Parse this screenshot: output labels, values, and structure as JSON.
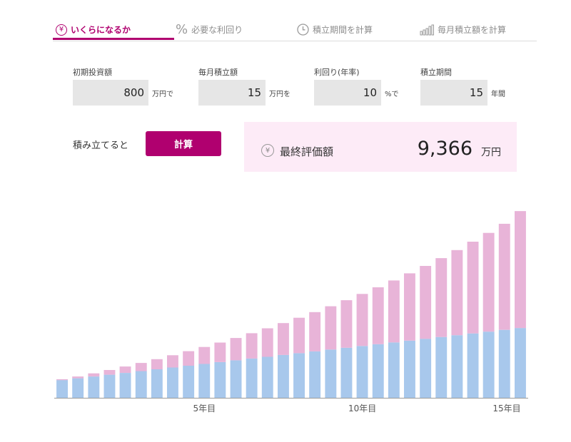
{
  "tabs": [
    {
      "label": "いくらになるか",
      "icon": "yen-circle-icon",
      "active": true
    },
    {
      "label": "必要な利回り",
      "icon": "percent-icon",
      "active": false
    },
    {
      "label": "積立期間を計算",
      "icon": "clock-icon",
      "active": false
    },
    {
      "label": "毎月積立額を計算",
      "icon": "bar-chart-icon",
      "active": false
    }
  ],
  "inputs": {
    "initial": {
      "label": "初期投資額",
      "value": "800",
      "unit": "万円で"
    },
    "monthly": {
      "label": "毎月積立額",
      "value": "15",
      "unit": "万円を"
    },
    "rate": {
      "label": "利回り(年率)",
      "value": "10",
      "unit": "%で"
    },
    "period": {
      "label": "積立期間",
      "value": "15",
      "unit": "年間"
    }
  },
  "calc": {
    "label": "積み立てると",
    "button": "計算"
  },
  "result": {
    "label": "最終評価額",
    "value": "9,366",
    "unit": "万円"
  },
  "colors": {
    "accent": "#b0006f",
    "principal": "#a8c8ec",
    "gain": "#e8b4d8",
    "result_bg": "#fdebf7"
  },
  "chart_data": {
    "type": "bar",
    "stacked": true,
    "x_tick_labels": [
      "5年目",
      "10年目",
      "15年目"
    ],
    "series": [
      {
        "values": [
          890,
          980,
          1070,
          1160,
          1250,
          1340,
          1430,
          1520,
          1610,
          1700,
          1790,
          1880,
          1970,
          2060,
          2150,
          2240,
          2330,
          2420,
          2510,
          2600,
          2690,
          2780,
          2870,
          2960,
          3050,
          3140,
          3230,
          3320,
          3410,
          3500
        ]
      },
      {
        "values": [
          45,
          88,
          158,
          235,
          319,
          410,
          508,
          614,
          728,
          850,
          981,
          1121,
          1270,
          1429,
          1598,
          1778,
          1969,
          2171,
          2385,
          2612,
          2853,
          3107,
          3375,
          3658,
          3957,
          4272,
          4604,
          4953,
          5320,
          5866
        ]
      }
    ],
    "ylim": [
      0,
      9800
    ]
  }
}
